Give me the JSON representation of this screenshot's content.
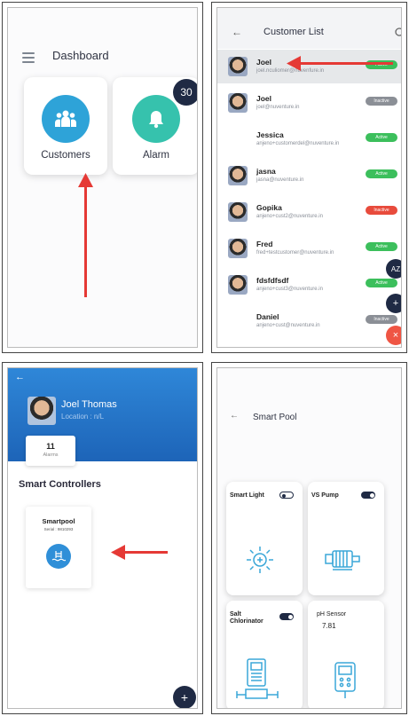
{
  "dashboard": {
    "title": "Dashboard",
    "cards": [
      {
        "label": "Customers",
        "icon": "customers-icon",
        "color": "#2ea3d8"
      },
      {
        "label": "Alarm",
        "icon": "bell-icon",
        "color": "#36c2ad",
        "badge": "30"
      }
    ]
  },
  "customer_list": {
    "title": "Customer List",
    "az_label": "AZ",
    "customers": [
      {
        "name": "Joel",
        "email": "joel.nculiomer@nuvenfure.in",
        "status": "Active",
        "status_color": "#3cbf5c",
        "avatar": true,
        "highlight": true
      },
      {
        "name": "Joel",
        "email": "joel@nuventure.in",
        "status": "Inactive",
        "status_color": "#8b8f96",
        "avatar": true,
        "highlight": false
      },
      {
        "name": "Jessica",
        "email": "anjeno+customerdel@nuventure.in",
        "status": "Active",
        "status_color": "#3cbf5c",
        "avatar": false,
        "highlight": false
      },
      {
        "name": "jasna",
        "email": "jasna@nuventure.in",
        "status": "Active",
        "status_color": "#3cbf5c",
        "avatar": true,
        "highlight": false
      },
      {
        "name": "Gopika",
        "email": "anjeno+cust2@nuventure.in",
        "status": "Inactive",
        "status_color": "#e84b3c",
        "avatar": true,
        "highlight": false
      },
      {
        "name": "Fred",
        "email": "fred+testcustomer@nuventure.in",
        "status": "Active",
        "status_color": "#3cbf5c",
        "avatar": true,
        "highlight": false
      },
      {
        "name": "fdsfdfsdf",
        "email": "anjeno+cust3@nuventure.in",
        "status": "Active",
        "status_color": "#3cbf5c",
        "avatar": true,
        "highlight": false
      },
      {
        "name": "Daniel",
        "email": "anjeno+cust@nuventure.in",
        "status": "Inactive",
        "status_color": "#8b8f96",
        "avatar": false,
        "highlight": false
      }
    ]
  },
  "customer_detail": {
    "name": "Joel Thomas",
    "location": "Location : n/L",
    "alarms_count": "11",
    "alarms_label": "Alarms",
    "section_title": "Smart Controllers",
    "controller": {
      "name": "Smartpool",
      "serial": "Serial : 9810293"
    }
  },
  "smart_pool": {
    "title": "Smart Pool",
    "devices": [
      {
        "label": "Smart Light",
        "on": false,
        "value": "",
        "icon": "light-icon"
      },
      {
        "label": "VS Pump",
        "on": true,
        "value": "",
        "icon": "pump-icon"
      },
      {
        "label": "Salt Chlorinator",
        "on": true,
        "value": "",
        "icon": "chlorinator-icon"
      },
      {
        "label": "pH Sensor",
        "on": null,
        "value": "7.81",
        "icon": "ph-meter-icon"
      }
    ]
  },
  "colors": {
    "accent_blue": "#2f87d8",
    "navy": "#1f2a44",
    "arrow_red": "#e53935"
  }
}
